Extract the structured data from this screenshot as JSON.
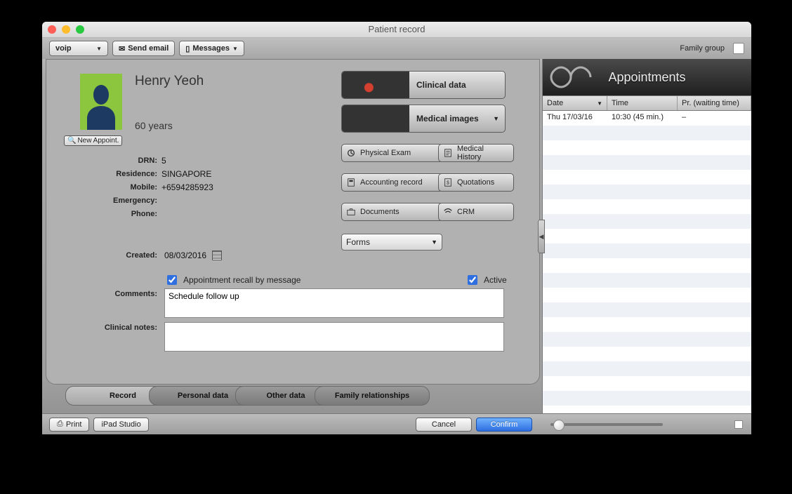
{
  "window": {
    "title": "Patient record"
  },
  "toolbar": {
    "voip": "voip",
    "send_email": "Send email",
    "messages": "Messages",
    "family_group": "Family group"
  },
  "patient": {
    "name": "Henry Yeoh",
    "age": "60 years",
    "new_appoint": "New Appoint.",
    "fields": {
      "drn_label": "DRN:",
      "drn": "5",
      "residence_label": "Residence:",
      "residence": "SINGAPORE",
      "mobile_label": "Mobile:",
      "mobile": "+6594285923",
      "emergency_label": "Emergency:",
      "emergency": "",
      "phone_label": "Phone:",
      "phone": ""
    },
    "created_label": "Created:",
    "created": "08/03/2016",
    "recall_label": "Appointment recall by message",
    "recall_checked": true,
    "active_label": "Active",
    "active_checked": true,
    "comments_label": "Comments:",
    "comments": "Schedule follow up",
    "clinical_notes_label": "Clinical notes:",
    "clinical_notes": ""
  },
  "buttons": {
    "clinical_data": "Clinical data",
    "medical_images": "Medical images",
    "physical_exam": "Physical Exam",
    "medical_history": "Medical History",
    "accounting_record": "Accounting record",
    "quotations": "Quotations",
    "documents": "Documents",
    "crm": "CRM",
    "forms": "Forms"
  },
  "tabs": {
    "record": "Record",
    "personal_data": "Personal data",
    "other_data": "Other data",
    "family_relationships": "Family relationships"
  },
  "appointments": {
    "title": "Appointments",
    "cols": {
      "date": "Date",
      "time": "Time",
      "pr": "Pr. (waiting time)"
    },
    "rows": [
      {
        "date": "Thu 17/03/16",
        "time": "10:30 (45 min.)",
        "pr": "–"
      }
    ],
    "blank_rows": 20
  },
  "footer": {
    "print": "Print",
    "ipad": "iPad Studio",
    "cancel": "Cancel",
    "confirm": "Confirm"
  }
}
